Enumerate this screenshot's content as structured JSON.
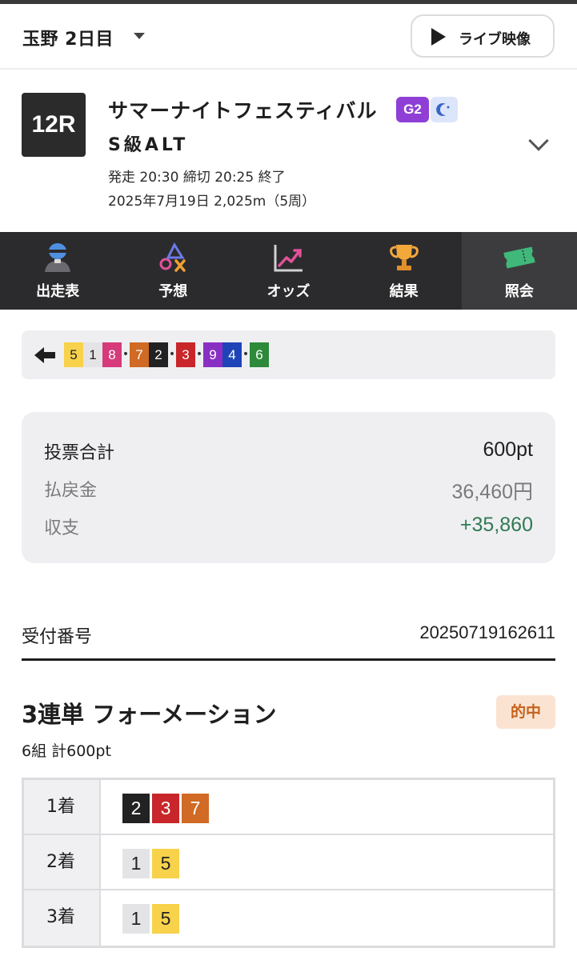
{
  "header": {
    "venue": "玉野 2日目",
    "live_label": "ライブ映像"
  },
  "race": {
    "number": "12R",
    "name": "サマーナイトフェスティバル",
    "grade": "G2",
    "night_icon": "moon-star-icon",
    "class": "S級ALT",
    "meta_line1": "発走 20:30 締切 20:25  終了",
    "meta_line2": "2025年7月19日 2,025m（5周）"
  },
  "nav": {
    "items": [
      {
        "label": "出走表",
        "icon": "racer-icon"
      },
      {
        "label": "予想",
        "icon": "prediction-icon"
      },
      {
        "label": "オッズ",
        "icon": "odds-chart-icon"
      },
      {
        "label": "結果",
        "icon": "trophy-icon"
      },
      {
        "label": "照会",
        "icon": "ticket-icon",
        "active": true
      }
    ]
  },
  "order": {
    "sequence": [
      {
        "n": "5",
        "bg": "#f7d24a",
        "fg": "#222222",
        "dot_after": false
      },
      {
        "n": "1",
        "bg": "#e4e4e6",
        "fg": "#222222",
        "dot_after": false
      },
      {
        "n": "8",
        "bg": "#d63a7a",
        "fg": "#ffffff",
        "dot_after": true
      },
      {
        "n": "7",
        "bg": "#d06a24",
        "fg": "#ffffff",
        "dot_after": false
      },
      {
        "n": "2",
        "bg": "#222222",
        "fg": "#ffffff",
        "dot_after": true
      },
      {
        "n": "3",
        "bg": "#c8262a",
        "fg": "#ffffff",
        "dot_after": true
      },
      {
        "n": "9",
        "bg": "#8a2fc4",
        "fg": "#ffffff",
        "dot_after": false
      },
      {
        "n": "4",
        "bg": "#1f44b8",
        "fg": "#ffffff",
        "dot_after": true
      },
      {
        "n": "6",
        "bg": "#2d8a3a",
        "fg": "#ffffff",
        "dot_after": false
      }
    ]
  },
  "summary": {
    "vote_total_label": "投票合計",
    "vote_total_value": "600pt",
    "payout_label": "払戻金",
    "payout_value": "36,460円",
    "balance_label": "収支",
    "balance_value": "+35,860",
    "balance_color": "#2f7a52"
  },
  "receipt": {
    "label": "受付番号",
    "value": "20250719162611"
  },
  "bet": {
    "title": "3連単 フォーメーション",
    "subtitle": "6組 計600pt",
    "status": "的中",
    "rows": [
      {
        "label": "1着",
        "picks": [
          {
            "n": "2",
            "bg": "#222222",
            "fg": "#ffffff"
          },
          {
            "n": "3",
            "bg": "#c8262a",
            "fg": "#ffffff"
          },
          {
            "n": "7",
            "bg": "#d06a24",
            "fg": "#ffffff"
          }
        ]
      },
      {
        "label": "2着",
        "picks": [
          {
            "n": "1",
            "bg": "#e4e4e6",
            "fg": "#222222"
          },
          {
            "n": "5",
            "bg": "#f7d24a",
            "fg": "#222222"
          }
        ]
      },
      {
        "label": "3着",
        "picks": [
          {
            "n": "1",
            "bg": "#e4e4e6",
            "fg": "#222222"
          },
          {
            "n": "5",
            "bg": "#f7d24a",
            "fg": "#222222"
          }
        ]
      }
    ]
  }
}
